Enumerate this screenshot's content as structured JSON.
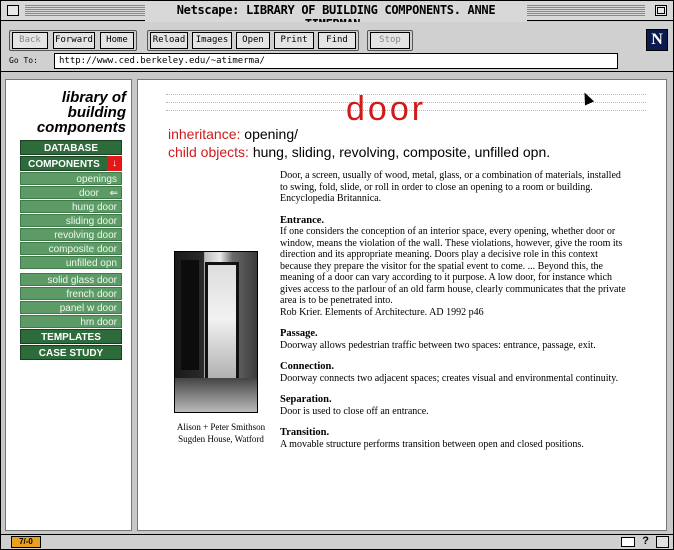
{
  "window": {
    "title": "Netscape: LIBRARY OF BUILDING COMPONENTS. ANNE TIMERMAN."
  },
  "toolbar": {
    "back": "Back",
    "forward": "Forward",
    "home": "Home",
    "reload": "Reload",
    "images": "Images",
    "open": "Open",
    "print": "Print",
    "find": "Find",
    "stop": "Stop",
    "logo": "N"
  },
  "location": {
    "label": "Go To:",
    "url": "http://www.ced.berkeley.edu/~atimerma/"
  },
  "sidebar": {
    "title_lines": [
      "library of",
      "building",
      "components"
    ],
    "top_buttons": [
      "DATABASE",
      "COMPONENTS"
    ],
    "components_arrow": "↓",
    "sub_items": [
      "openings",
      "door",
      "hung door",
      "sliding door",
      "revolving door",
      "composite door",
      "unfilled opn"
    ],
    "current_arrow": "⇐",
    "sub_items_2": [
      "solid glass door",
      "french door",
      "panel w door",
      "hm door"
    ],
    "bottom_buttons": [
      "TEMPLATES",
      "CASE STUDY"
    ]
  },
  "main": {
    "title": "door",
    "inheritance_label": "inheritance:",
    "inheritance_value": "opening/",
    "children_label": "child objects:",
    "children_value": "hung, sliding, revolving, composite, unfilled opn.",
    "photo_caption": "Alison + Peter Smithson Sugden House, Watford",
    "intro": "Door, a screen, usually of wood, metal, glass, or a combination of materials, installed to swing, fold, slide, or roll in order to close an opening to a room or building. Encyclopedia Britannica.",
    "sections": [
      {
        "heading": "Entrance.",
        "text": "If one considers the conception of an interior space, every opening, whether door or window, means the violation of the wall. These violations, however, give the room its direction and its appropriate meaning. Doors play a decisive role in this context because they prepare the visitor for the spatial event to come. ... Beyond this, the meaning of a door can vary according to it purpose. A low door, for instance which gives access to the parlour of an old farm house, clearly communicates that the private area is to be penetrated into.",
        "source": "Rob Krier. Elements of Architecture. AD 1992 p46"
      },
      {
        "heading": "Passage.",
        "text": "Doorway allows pedestrian traffic between two spaces: entrance, passage, exit."
      },
      {
        "heading": "Connection.",
        "text": "Doorway connects two adjacent spaces; creates visual and environmental continuity."
      },
      {
        "heading": "Separation.",
        "text": "Door is used to close off an entrance."
      },
      {
        "heading": "Transition.",
        "text": "A movable structure performs transition between open and closed positions."
      }
    ]
  },
  "statusbar": {
    "security": "7/-0",
    "help": "?"
  },
  "colors": {
    "nav_dark": "#2e6b3a",
    "nav_light": "#5d9b66",
    "accent_red": "#d11a1a"
  }
}
